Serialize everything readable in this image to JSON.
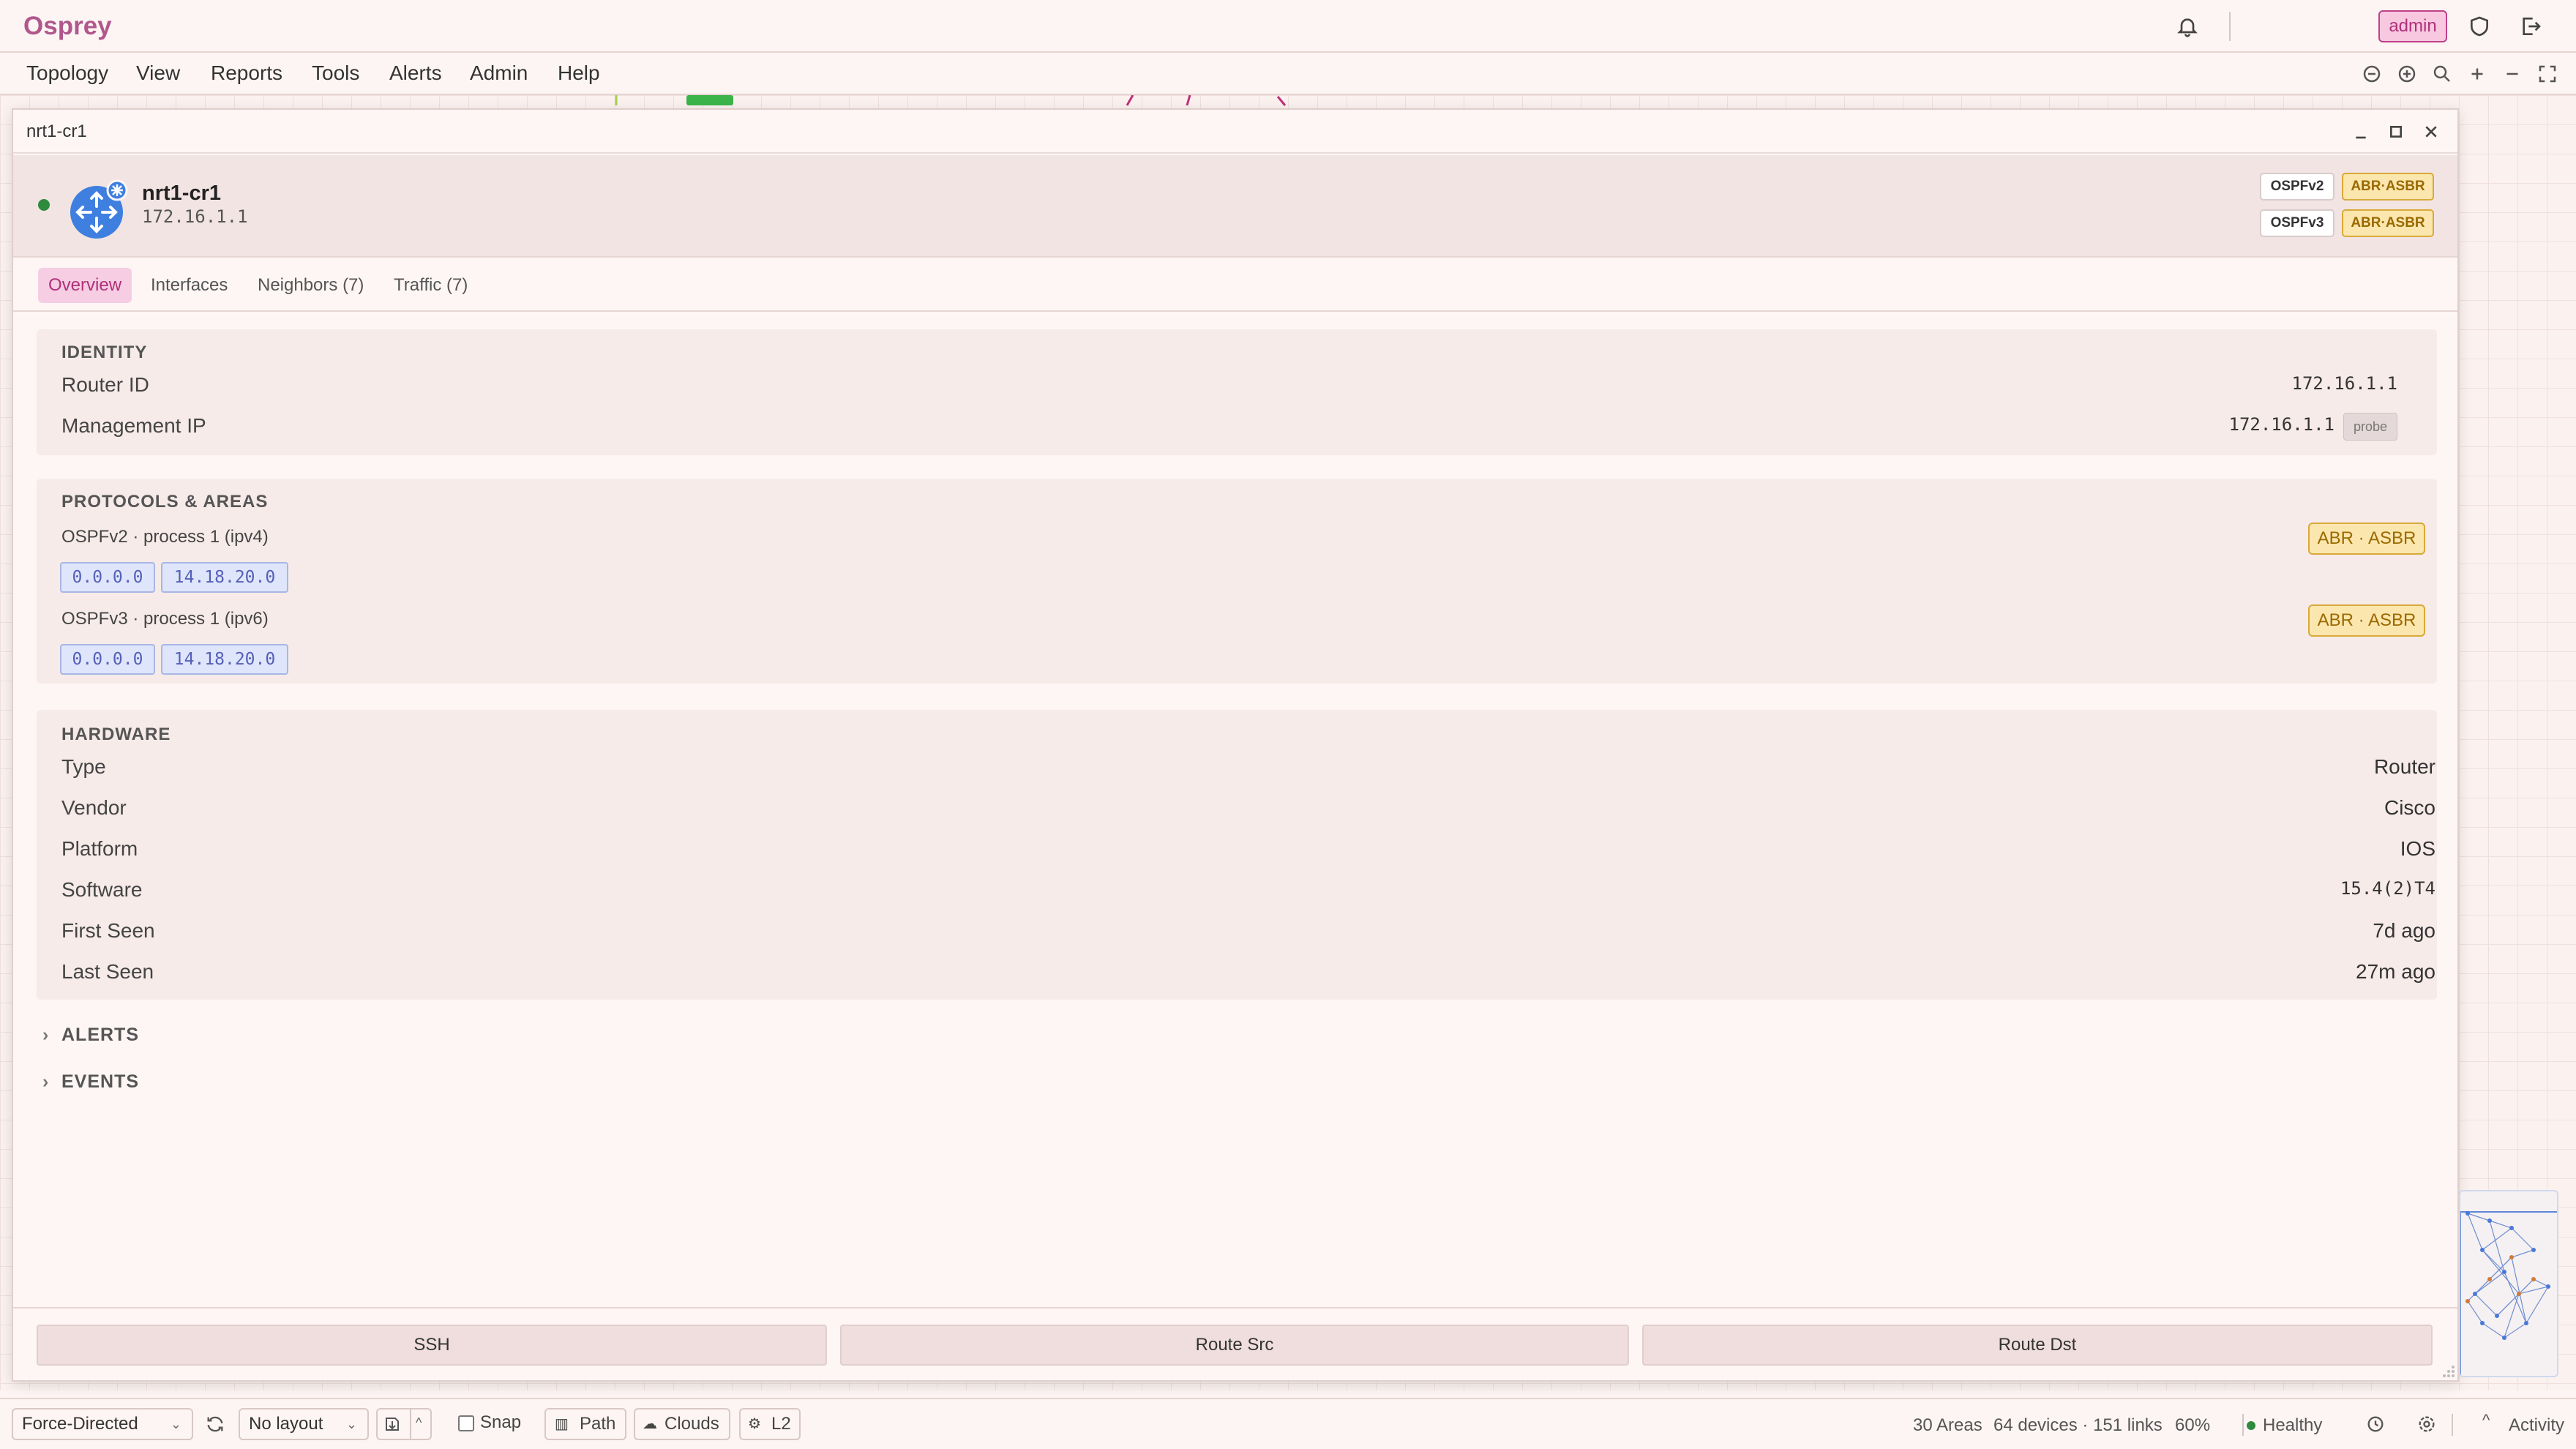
{
  "app": {
    "name": "Osprey",
    "user": "admin"
  },
  "menu": [
    "Topology",
    "View",
    "Reports",
    "Tools",
    "Alerts",
    "Admin",
    "Help"
  ],
  "window": {
    "title": "nrt1-cr1"
  },
  "device": {
    "name": "nrt1-cr1",
    "ip": "172.16.1.1",
    "status_color": "#2e8b3e",
    "protocol_badges": [
      {
        "protocol": "OSPFv2",
        "role": "ABR·ASBR"
      },
      {
        "protocol": "OSPFv3",
        "role": "ABR·ASBR"
      }
    ]
  },
  "tabs": [
    "Overview",
    "Interfaces",
    "Neighbors (7)",
    "Traffic (7)"
  ],
  "active_tab": "Overview",
  "identity": {
    "title": "IDENTITY",
    "rows": [
      {
        "label": "Router ID",
        "value": "172.16.1.1"
      },
      {
        "label": "Management IP",
        "value": "172.16.1.1",
        "badge": "probe"
      }
    ]
  },
  "protocols": {
    "title": "PROTOCOLS & AREAS",
    "items": [
      {
        "name": "OSPFv2 · process 1 (ipv4)",
        "areas": [
          "0.0.0.0",
          "14.18.20.0"
        ],
        "role": "ABR · ASBR"
      },
      {
        "name": "OSPFv3 · process 1 (ipv6)",
        "areas": [
          "0.0.0.0",
          "14.18.20.0"
        ],
        "role": "ABR · ASBR"
      }
    ]
  },
  "hardware": {
    "title": "HARDWARE",
    "rows": [
      {
        "label": "Type",
        "value": "Router"
      },
      {
        "label": "Vendor",
        "value": "Cisco"
      },
      {
        "label": "Platform",
        "value": "IOS"
      },
      {
        "label": "Software",
        "value": "15.4(2)T4"
      },
      {
        "label": "First Seen",
        "value": "7d ago"
      },
      {
        "label": "Last Seen",
        "value": "27m ago"
      }
    ]
  },
  "collapsibles": [
    "ALERTS",
    "EVENTS"
  ],
  "actions": [
    "SSH",
    "Route Src",
    "Route Dst"
  ],
  "statusbar": {
    "layout_algo": "Force-Directed",
    "saved_layout": "No layout",
    "snap": "Snap",
    "path": "Path",
    "clouds": "Clouds",
    "l2": "L2",
    "areas": "30 Areas",
    "stats": "64 devices · 151 links",
    "zoom": "60%",
    "health": "Healthy",
    "activity": "Activity"
  },
  "colors": {
    "brand": "#b0578d",
    "healthy": "#2e8b3e",
    "role_bg": "#fbe6ae",
    "area_chip": "#dfe6fb"
  }
}
